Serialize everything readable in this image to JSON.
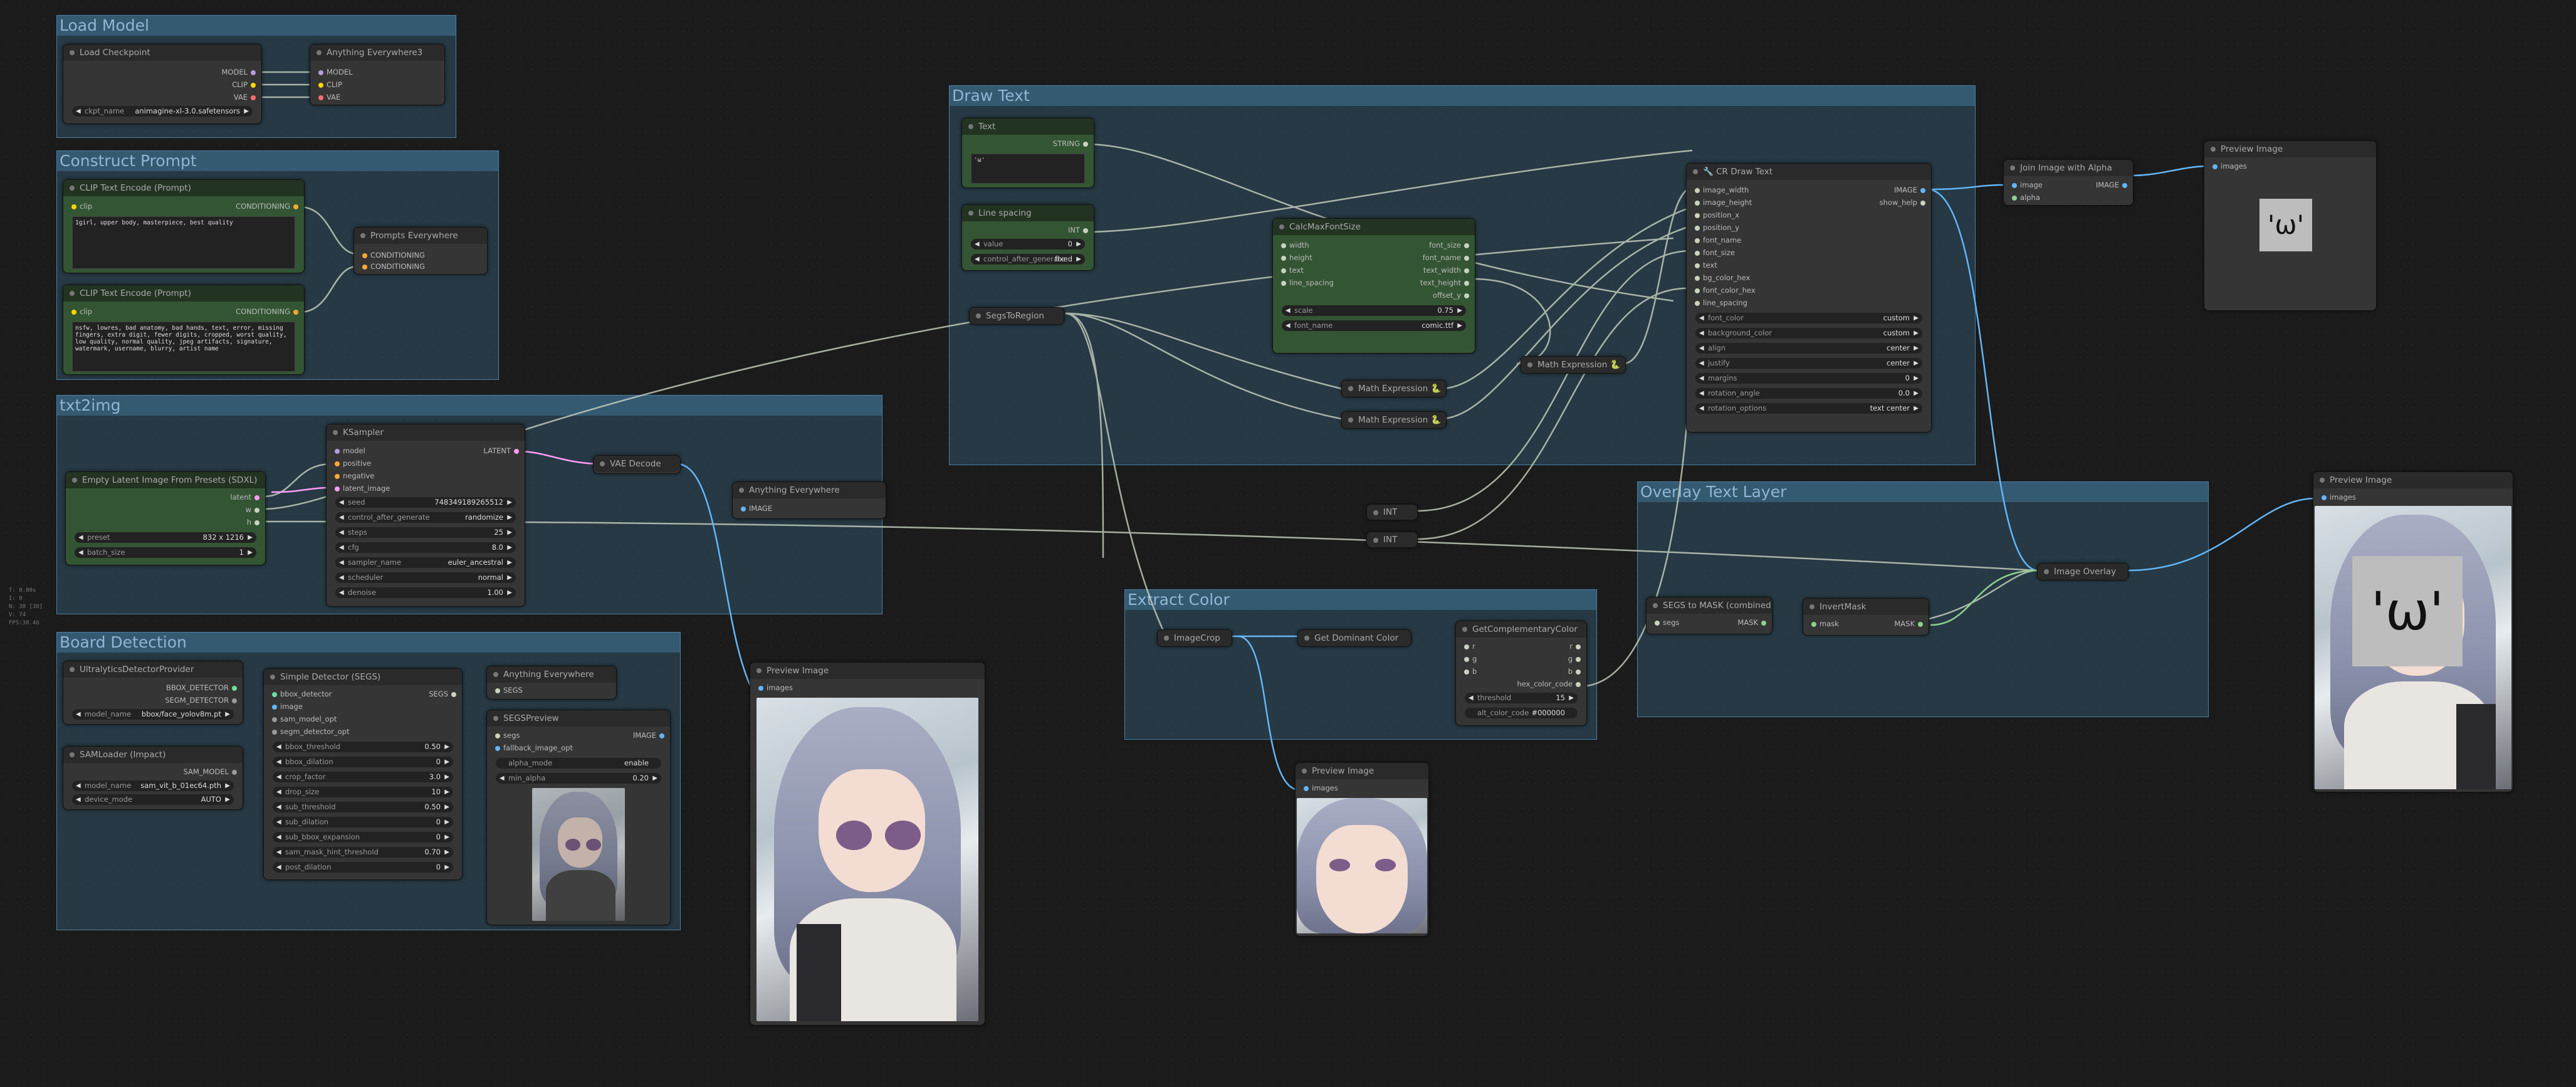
{
  "stats": [
    "T: 0.00s",
    "I: 0",
    "N: 38 [38]",
    "V: 74",
    "FPS:38.46"
  ],
  "groups": {
    "load_model": "Load Model",
    "construct_prompt": "Construct Prompt",
    "txt2img": "txt2img",
    "board_detection": "Board Detection",
    "draw_text": "Draw Text",
    "extract_color": "Extract Color",
    "overlay_text_layer": "Overlay Text Layer"
  },
  "nodes": {
    "load_checkpoint": {
      "title": "Load Checkpoint",
      "out": [
        "MODEL",
        "CLIP",
        "VAE"
      ],
      "ckpt_label": "ckpt_name",
      "ckpt_value": "animagine-xl-3.0.safetensors"
    },
    "anything_everywhere3": {
      "title": "Anything Everywhere3",
      "in": [
        "MODEL",
        "CLIP",
        "VAE"
      ]
    },
    "clip_pos": {
      "title": "CLIP Text Encode (Prompt)",
      "in": "clip",
      "out": "CONDITIONING",
      "text": "1girl, upper body, masterpiece, best quality"
    },
    "clip_neg": {
      "title": "CLIP Text Encode (Prompt)",
      "in": "clip",
      "out": "CONDITIONING",
      "text": "nsfw, lowres, bad anatomy, bad hands, text, error, missing fingers, extra digit, fewer digits, cropped, worst quality, low quality, normal quality, jpeg artifacts, signature, watermark, username, blurry, artist name"
    },
    "prompts_everywhere": {
      "title": "Prompts Everywhere",
      "in": [
        "CONDITIONING",
        "CONDITIONING"
      ]
    },
    "empty_latent": {
      "title": "Empty Latent Image From Presets (SDXL)",
      "out": [
        "latent",
        "w",
        "h"
      ],
      "preset_label": "preset",
      "preset_value": "832 x 1216",
      "batch_label": "batch_size",
      "batch_value": "1"
    },
    "ksampler": {
      "title": "KSampler",
      "in": [
        "model",
        "positive",
        "negative",
        "latent_image"
      ],
      "out": "LATENT",
      "widgets": [
        [
          "seed",
          "748349189265512"
        ],
        [
          "control_after_generate",
          "randomize"
        ],
        [
          "steps",
          "25"
        ],
        [
          "cfg",
          "8.0"
        ],
        [
          "sampler_name",
          "euler_ancestral"
        ],
        [
          "scheduler",
          "normal"
        ],
        [
          "denoise",
          "1.00"
        ]
      ]
    },
    "vae_decode": {
      "title": "VAE Decode"
    },
    "anything_everywhere": {
      "title": "Anything Everywhere",
      "in": "IMAGE"
    },
    "preview_main": {
      "title": "Preview Image",
      "in": "images"
    },
    "ultralytics": {
      "title": "UltralyticsDetectorProvider",
      "out": [
        "BBOX_DETECTOR",
        "SEGM_DETECTOR"
      ],
      "model_label": "model_name",
      "model_value": "bbox/face_yolov8m.pt"
    },
    "samloader": {
      "title": "SAMLoader (Impact)",
      "out": "SAM_MODEL",
      "w": [
        [
          "model_name",
          "sam_vit_b_01ec64.pth"
        ],
        [
          "device_mode",
          "AUTO"
        ]
      ]
    },
    "simple_detector": {
      "title": "Simple Detector (SEGS)",
      "in": [
        "bbox_detector",
        "image",
        "sam_model_opt",
        "segm_detector_opt"
      ],
      "out": "SEGS",
      "widgets": [
        [
          "bbox_threshold",
          "0.50"
        ],
        [
          "bbox_dilation",
          "0"
        ],
        [
          "crop_factor",
          "3.0"
        ],
        [
          "drop_size",
          "10"
        ],
        [
          "sub_threshold",
          "0.50"
        ],
        [
          "sub_dilation",
          "0"
        ],
        [
          "sub_bbox_expansion",
          "0"
        ],
        [
          "sam_mask_hint_threshold",
          "0.70"
        ],
        [
          "post_dilation",
          "0"
        ]
      ]
    },
    "anything_everywhere_segs": {
      "title": "Anything Everywhere",
      "in": "SEGS"
    },
    "segs_preview": {
      "title": "SEGSPreview",
      "in": [
        "segs",
        "fallback_image_opt"
      ],
      "out": "IMAGE",
      "w": [
        [
          "alpha_mode",
          "enable"
        ],
        [
          "min_alpha",
          "0.20"
        ]
      ]
    },
    "text": {
      "title": "Text",
      "out": "STRING",
      "value": "'ω'"
    },
    "line_spacing": {
      "title": "Line spacing",
      "out": "INT",
      "w": [
        [
          "value",
          "0"
        ],
        [
          "control_after_generate",
          "fixed"
        ]
      ]
    },
    "segs_to_region": {
      "title": "SegsToRegion"
    },
    "calc_max_font": {
      "title": "CalcMaxFontSize",
      "in": [
        "width",
        "height",
        "text",
        "line_spacing"
      ],
      "out": [
        "font_size",
        "font_name",
        "text_width",
        "text_height",
        "offset_y"
      ],
      "w": [
        [
          "scale",
          "0.75"
        ],
        [
          "font_name",
          "comic.ttf"
        ]
      ]
    },
    "cr_draw_text": {
      "title": "🔧 CR Draw Text",
      "in": [
        "image_width",
        "image_height",
        "position_x",
        "position_y",
        "font_name",
        "font_size",
        "text",
        "bg_color_hex",
        "font_color_hex",
        "line_spacing"
      ],
      "out": [
        "IMAGE",
        "show_help"
      ],
      "widgets": [
        [
          "font_color",
          "custom"
        ],
        [
          "background_color",
          "custom"
        ],
        [
          "align",
          "center"
        ],
        [
          "justify",
          "center"
        ],
        [
          "margins",
          "0"
        ],
        [
          "rotation_angle",
          "0.0"
        ],
        [
          "rotation_options",
          "text center"
        ]
      ]
    },
    "join_alpha": {
      "title": "Join Image with Alpha",
      "in": [
        "image",
        "alpha"
      ],
      "out": "IMAGE"
    },
    "preview_text": {
      "title": "Preview Image",
      "in": "images",
      "emoji": "'ω'"
    },
    "math1": {
      "title": "Math Expression 🐍"
    },
    "math2": {
      "title": "Math Expression 🐍"
    },
    "math3": {
      "title": "Math Expression 🐍"
    },
    "int1": {
      "title": "INT"
    },
    "int2": {
      "title": "INT"
    },
    "image_crop": {
      "title": "ImageCrop"
    },
    "get_dominant": {
      "title": "Get Dominant Color"
    },
    "get_complementary": {
      "title": "GetComplementaryColor",
      "in": [
        "r",
        "g",
        "b"
      ],
      "out": [
        "r",
        "g",
        "b",
        "hex_color_code"
      ],
      "w": [
        [
          "threshold",
          "15"
        ],
        [
          "alt_color_code",
          "#000000"
        ]
      ]
    },
    "preview_crop": {
      "title": "Preview Image",
      "in": "images"
    },
    "segs_to_mask": {
      "title": "SEGS to MASK (combined)",
      "in": "segs",
      "out": "MASK"
    },
    "invert_mask": {
      "title": "InvertMask",
      "in": "mask",
      "out": "MASK"
    },
    "image_overlay": {
      "title": "Image Overlay"
    },
    "preview_final": {
      "title": "Preview Image",
      "in": "images",
      "emoji": "'ω'"
    }
  },
  "colors": {
    "bg": "#1b1b1b",
    "group": "#3f789c",
    "node": "#353535",
    "green_node": "#335533",
    "wire_image": "#64b5f6",
    "wire_latent": "#ff9cf9",
    "wire_other": "#c8d2c0"
  }
}
